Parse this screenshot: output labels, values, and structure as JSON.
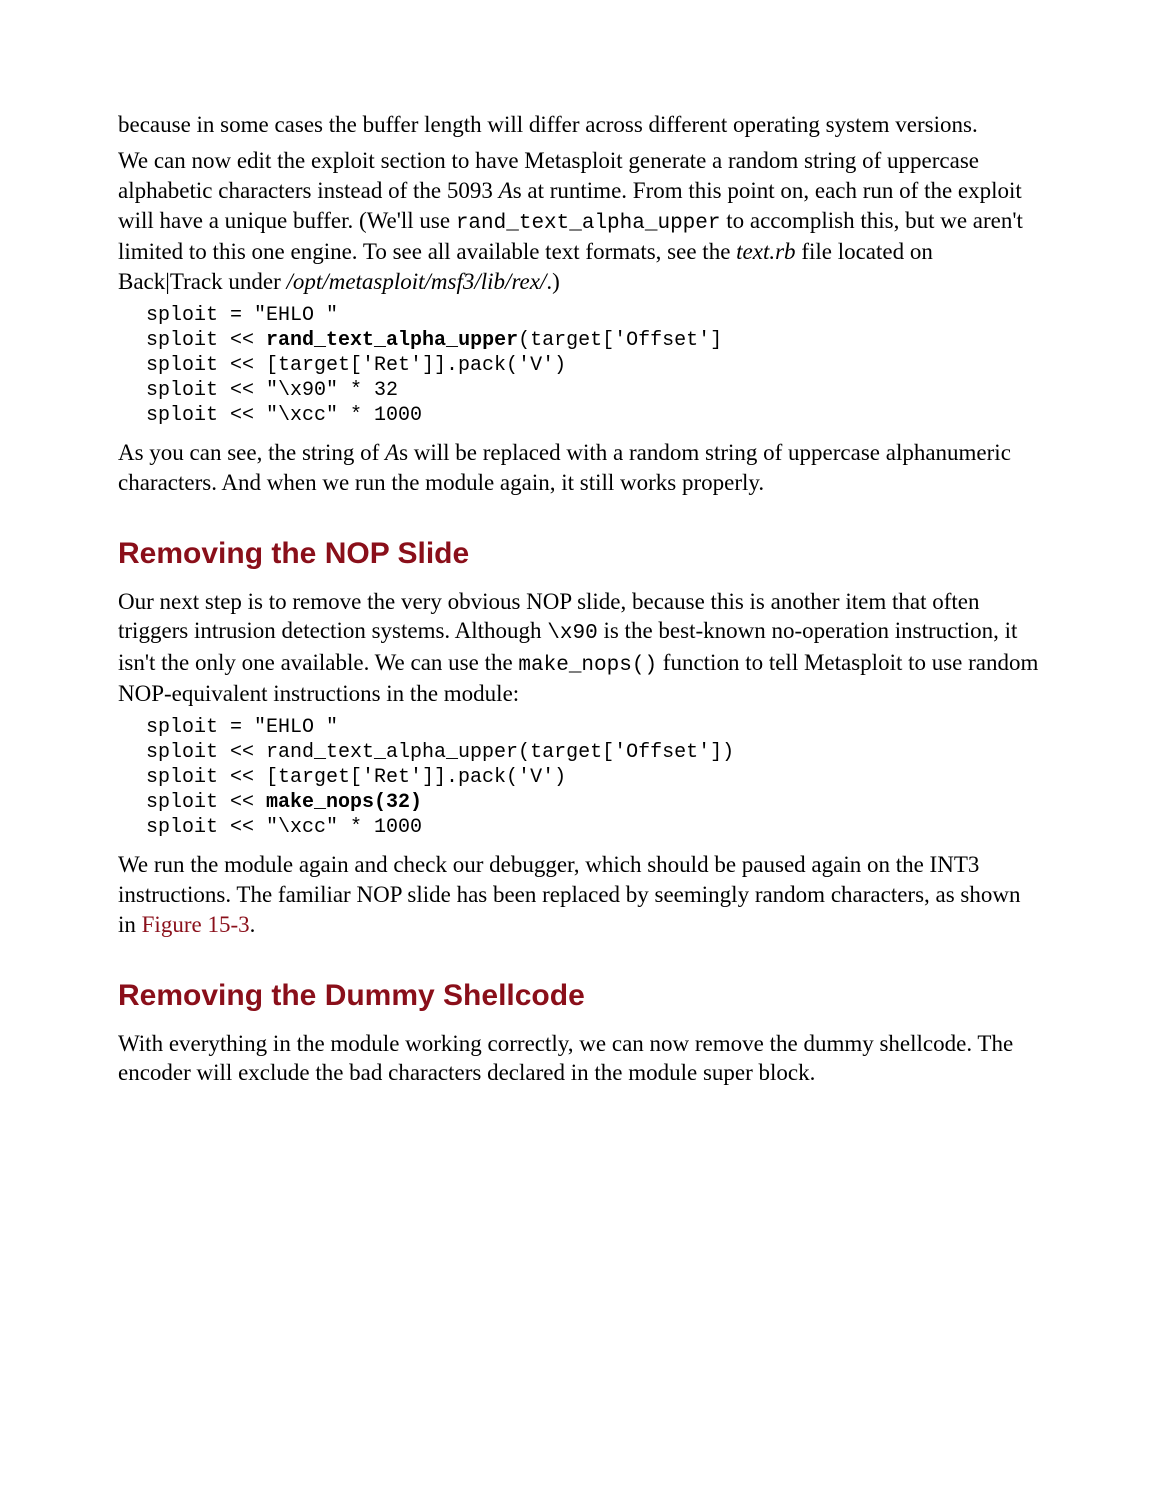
{
  "para1": "because in some cases the buffer length will differ across different operating system versions.",
  "para2_a": "We can now edit the exploit section to have Metasploit generate a random string of uppercase alphabetic characters instead of the 5093 ",
  "para2_italic1": "A",
  "para2_b": "s at runtime. From this point on, each run of the exploit will have a unique buffer. (We'll use ",
  "para2_code": "rand_text_alpha_upper",
  "para2_c": " to accomplish this, but we aren't limited to this one engine. To see all available text formats, see the ",
  "para2_italic2": "text.rb",
  "para2_d": " file located on Back|Track under ",
  "para2_italic3": "/opt/metasploit/msf3/lib/rex/",
  "para2_e": ".)",
  "code1_l1": "sploit = \"EHLO \"",
  "code1_l2a": "sploit << ",
  "code1_l2b": "rand_text_alpha_upper",
  "code1_l2c": "(target['Offset']",
  "code1_l3": "sploit << [target['Ret']].pack('V')",
  "code1_l4": "sploit << \"\\x90\" * 32",
  "code1_l5": "sploit << \"\\xcc\" * 1000",
  "para3_a": "As you can see, the string of ",
  "para3_italic": "A",
  "para3_b": "s will be replaced with a random string of uppercase alphanumeric characters. And when we run the module again, it still works properly.",
  "heading1": "Removing the NOP Slide",
  "para4_a": "Our next step is to remove the very obvious NOP slide, because this is another item that often triggers intrusion detection systems. Although ",
  "para4_code1": "\\x90",
  "para4_b": " is the best-known no-operation instruction, it isn't the only one available. We can use the ",
  "para4_code2": "make_nops()",
  "para4_c": " function to tell Metasploit to use random NOP-equivalent instructions in the module:",
  "code2_l1": "sploit = \"EHLO \"",
  "code2_l2": "sploit << rand_text_alpha_upper(target['Offset'])",
  "code2_l3": "sploit << [target['Ret']].pack('V')",
  "code2_l4a": "sploit << ",
  "code2_l4b": "make_nops(32)",
  "code2_l5": "sploit << \"\\xcc\" * 1000",
  "para5_a": "We run the module again and check our debugger, which should be paused again on the INT3 instructions. The familiar NOP slide has been replaced by seemingly random characters, as shown in ",
  "para5_link": "Figure 15-3",
  "para5_b": ".",
  "heading2": "Removing the Dummy Shellcode",
  "para6": "With everything in the module working correctly, we can now remove the dummy shellcode. The encoder will exclude the bad characters declared in the module super block."
}
